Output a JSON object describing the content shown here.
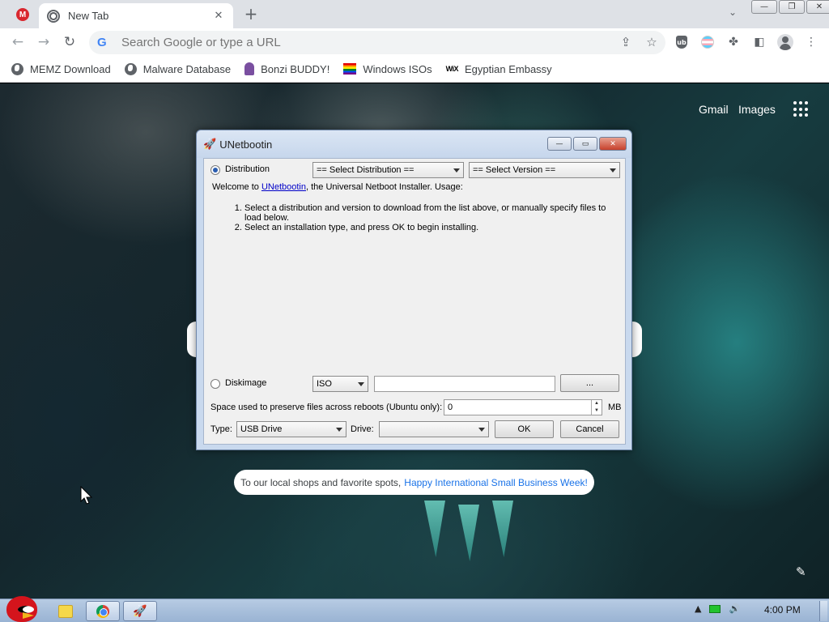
{
  "browser": {
    "pinned_tab_icon": "mega-icon",
    "active_tab": {
      "title": "New Tab",
      "favicon": "chrome-newtab-icon"
    },
    "new_tab_button": "+",
    "omnibox": {
      "placeholder": "Search Google or type a URL"
    },
    "bookmarks": [
      {
        "label": "MEMZ Download",
        "icon": "globe-icon"
      },
      {
        "label": "Malware Database",
        "icon": "globe-icon"
      },
      {
        "label": "Bonzi BUDDY!",
        "icon": "bonzi-icon"
      },
      {
        "label": "Windows ISOs",
        "icon": "rainbow-flag-icon"
      },
      {
        "label": "Egyptian Embassy",
        "icon": "wix-icon",
        "icon_text": "WiX"
      }
    ]
  },
  "newtab": {
    "gmail_label": "Gmail",
    "images_label": "Images",
    "notice_text": "To our local shops and favorite spots,",
    "notice_link": "Happy International Small Business Week!"
  },
  "dialog": {
    "title": "UNetbootin",
    "distribution_label": "Distribution",
    "distribution_select": "== Select Distribution ==",
    "version_select": "== Select Version ==",
    "welcome_prefix": "Welcome to ",
    "welcome_link": "UNetbootin",
    "welcome_suffix": ", the Universal Netboot Installer. Usage:",
    "steps": [
      "Select a distribution and version to download from the list above, or manually specify files to load below.",
      "Select an installation type, and press OK to begin installing."
    ],
    "diskimage_label": "Diskimage",
    "diskimage_type": "ISO",
    "diskimage_path": "",
    "browse_label": "...",
    "space_label": "Space used to preserve files across reboots (Ubuntu only):",
    "space_value": "0",
    "space_unit": "MB",
    "type_label": "Type:",
    "type_value": "USB Drive",
    "drive_label": "Drive:",
    "drive_value": "",
    "ok_label": "OK",
    "cancel_label": "Cancel",
    "selected_mode": "Distribution"
  },
  "taskbar": {
    "clock": "4:00 PM"
  }
}
